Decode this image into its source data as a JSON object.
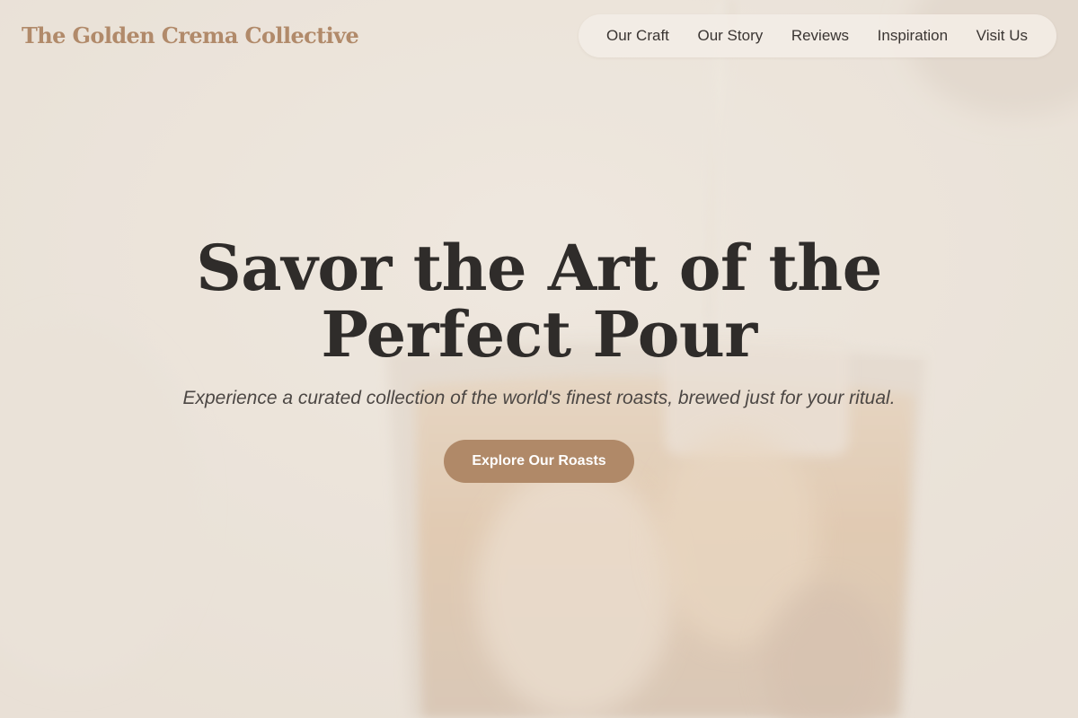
{
  "header": {
    "brand": "The Golden Crema Collective"
  },
  "nav": {
    "items": [
      {
        "label": "Our Craft"
      },
      {
        "label": "Our Story"
      },
      {
        "label": "Reviews"
      },
      {
        "label": "Inspiration"
      },
      {
        "label": "Visit Us"
      }
    ]
  },
  "hero": {
    "title": "Savor the Art of the Perfect Pour",
    "subtitle": "Experience a curated collection of the world's finest roasts, brewed just for your ritual.",
    "cta_label": "Explore Our Roasts"
  },
  "colors": {
    "brand": "#b18a6a",
    "accent": "#b08968",
    "heading": "#2f2c2a",
    "background": "#ebe3da"
  }
}
